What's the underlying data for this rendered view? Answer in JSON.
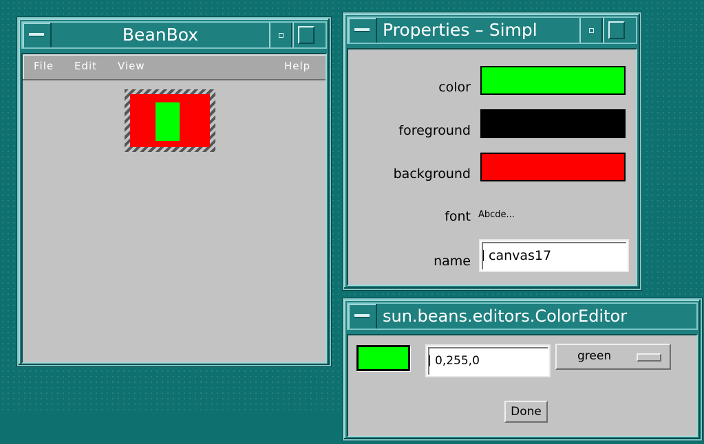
{
  "beanbox": {
    "title": "BeanBox",
    "menu": {
      "file": "File",
      "edit": "Edit",
      "view": "View",
      "help": "Help"
    },
    "bean": {
      "canvas_color": "#ff0000",
      "inner_color": "#00ff00"
    }
  },
  "properties": {
    "title": "Properties – Simpl",
    "color_label": "color",
    "color_value": "#00ff00",
    "foreground_label": "foreground",
    "foreground_value": "#000000",
    "background_label": "background",
    "background_value": "#ff0000",
    "font_label": "font",
    "font_value": "Abcde...",
    "name_label": "name",
    "name_value": "canvas17"
  },
  "color_editor": {
    "title": "sun.beans.editors.ColorEditor",
    "swatch_color": "#00ff00",
    "rgb_value": "0,255,0",
    "color_choice": "green",
    "done_label": "Done"
  },
  "icons": [
    "window-menu-icon",
    "minimize-icon",
    "maximize-icon"
  ]
}
